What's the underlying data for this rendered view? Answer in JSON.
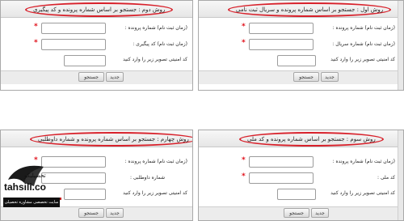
{
  "panels": {
    "top_left": {
      "title": "روش دوم : جستجو بر اساس شماره پرونده و کد پیگیری",
      "fields": [
        {
          "label": "(زمان ثبت نام) شماره پرونده :"
        },
        {
          "label": "(زمان ثبت نام) کد پیگیری :"
        },
        {
          "label": "کد امنیتی تصویر زیر را وارد کنید"
        }
      ],
      "search": "جستجو",
      "new": "جدید"
    },
    "top_right": {
      "title": "روش اول : جستجو بر اساس شماره پرونده و سریال ثبت نامی",
      "fields": [
        {
          "label": "(زمان ثبت نام) شماره پرونده :"
        },
        {
          "label": "(زمان ثبت نام) شماره سریال :"
        },
        {
          "label": "کد امنیتی تصویر زیر را وارد کنید"
        }
      ],
      "search": "جستجو",
      "new": "جدید"
    },
    "bottom_left": {
      "title": "روش چهارم : جستجو بر اساس شماره پرونده و شماره داوطلبی",
      "fields": [
        {
          "label": "(زمان ثبت نام) شماره پرونده :"
        },
        {
          "label": "شماره داوطلبی :"
        },
        {
          "label": "کد امنیتی تصویر زیر را وارد کنید"
        }
      ],
      "search": "جستجو",
      "new": "جدید"
    },
    "bottom_right": {
      "title": "روش سوم : جستجو بر اساس شماره پرونده و کد ملی",
      "fields": [
        {
          "label": "(زمان ثبت نام) شماره پرونده :"
        },
        {
          "label": "کد ملی :"
        },
        {
          "label": "کد امنیتی تصویر زیر را وارد کنید"
        }
      ],
      "search": "جستجو",
      "new": "جدید"
    }
  },
  "logo": {
    "word": "tahsili.co",
    "fa_word": "تحصیلیکو",
    "tagline": "سایت تخصصی مشاوره تحصیلی"
  },
  "colors": {
    "highlight": "#d8202a",
    "required": "#e0101a"
  }
}
